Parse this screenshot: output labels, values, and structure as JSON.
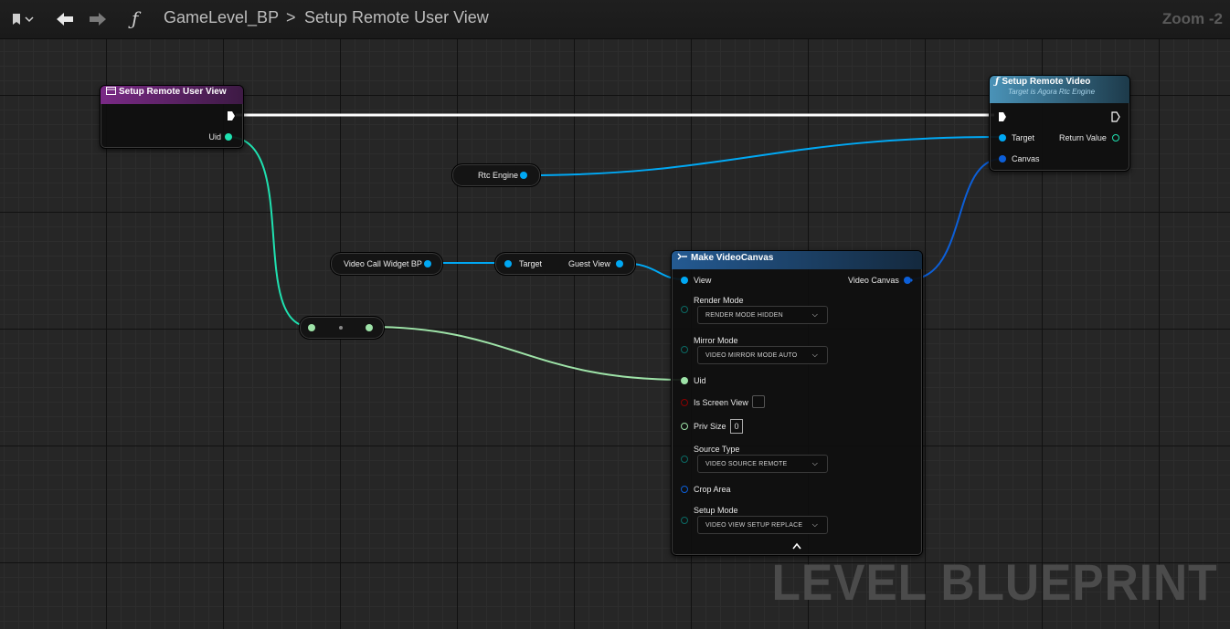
{
  "toolbar": {
    "function_glyph": "ƒ",
    "breadcrumb": [
      "GameLevel_BP",
      "Setup Remote User View"
    ],
    "separator": ">",
    "zoom": "Zoom -2"
  },
  "nodes": {
    "event": {
      "title": "Setup Remote User View",
      "uid_label": "Uid"
    },
    "setup_remote_video": {
      "title": "Setup Remote Video",
      "subtitle": "Target is Agora Rtc Engine",
      "target_label": "Target",
      "return_label": "Return Value",
      "canvas_label": "Canvas"
    },
    "rtc_engine": {
      "label": "Rtc Engine"
    },
    "video_call_widget": {
      "label": "Video Call Widget BP"
    },
    "guest_view": {
      "target_label": "Target",
      "output_label": "Guest View"
    },
    "make_video_canvas": {
      "title": "Make VideoCanvas",
      "view_label": "View",
      "output_label": "Video Canvas",
      "render_mode_label": "Render Mode",
      "render_mode_value": "RENDER MODE HIDDEN",
      "mirror_mode_label": "Mirror Mode",
      "mirror_mode_value": "VIDEO MIRROR MODE AUTO",
      "uid_label": "Uid",
      "is_screen_view_label": "Is Screen View",
      "is_screen_view_checked": false,
      "priv_size_label": "Priv Size",
      "priv_size_value": "0",
      "source_type_label": "Source Type",
      "source_type_value": "VIDEO SOURCE REMOTE",
      "crop_area_label": "Crop Area",
      "setup_mode_label": "Setup Mode",
      "setup_mode_value": "VIDEO VIEW SETUP REPLACE"
    }
  },
  "watermark": "LEVEL BLUEPRINT",
  "colors": {
    "exec": "#ffffff",
    "object": "#00a8f4",
    "int": "#1fe1b0",
    "uid_wire": "#9ee3a8",
    "struct": "#0c5fd8",
    "bool": "#8a0000",
    "event_header": "#6b1f74",
    "function_header": "#3d7fa0",
    "make_header": "#1d4a7a"
  }
}
